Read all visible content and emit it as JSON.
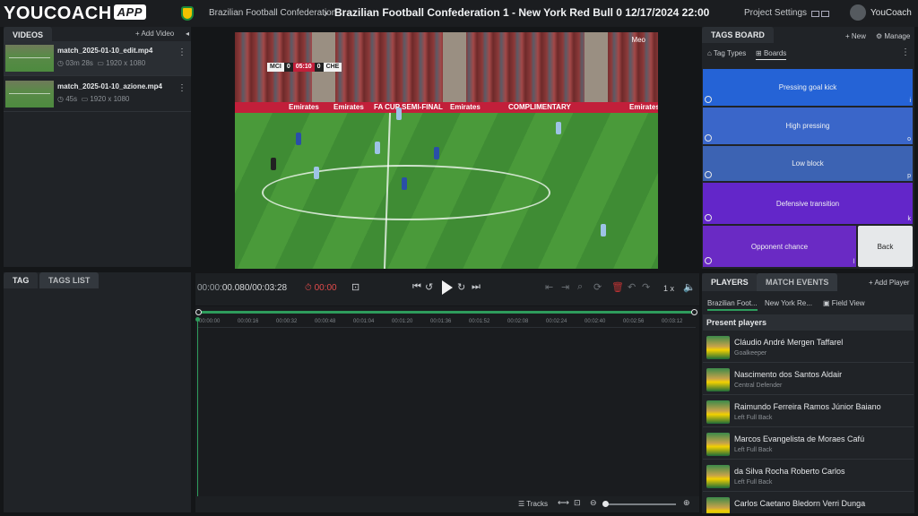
{
  "app": {
    "logo": "YOUCOACH",
    "logo_badge": "APP"
  },
  "header": {
    "breadcrumb": "Brazilian Football Confederation",
    "separator": "›",
    "match_title": "Brazilian Football Confederation 1 - New York Red Bull 0 12/17/2024 22:00",
    "project_settings": "Project Settings",
    "user_name": "YouCoach"
  },
  "videos": {
    "tab": "VIDEOS",
    "add_label": "+ Add Video",
    "collapse": "◂",
    "items": [
      {
        "name": "match_2025-01-10_edit.mp4",
        "duration": "◷ 03m 28s",
        "resolution": "▭ 1920 x 1080"
      },
      {
        "name": "match_2025-01-10_azione.mp4",
        "duration": "◷ 45s",
        "resolution": "▭ 1920 x 1080"
      }
    ],
    "menu": "⋮"
  },
  "tag_panel": {
    "tab_tag": "TAG",
    "tab_list": "TAGS LIST"
  },
  "player": {
    "home": "MCI",
    "home_score": "0",
    "clock": "05:10",
    "away_score": "0",
    "away": "CHE",
    "watermark": "Meo",
    "ads": [
      "Emirates",
      "Emirates",
      "FA CUP SEMI-FINAL",
      "Emirates",
      "COMPLIMENTARY",
      "Emirates"
    ]
  },
  "controls": {
    "time_prefix": "00:00:",
    "time_current": "00.080",
    "time_sep": "/",
    "time_total": "00:03:28",
    "stopwatch": "⏱ 00:00",
    "speed": "1 x"
  },
  "timeline": {
    "ticks": [
      "00:00:00",
      "00:00:16",
      "00:00:32",
      "00:00:48",
      "00:01:04",
      "00:01:20",
      "00:01:36",
      "00:01:52",
      "00:02:08",
      "00:02:24",
      "00:02:40",
      "00:02:56",
      "00:03:12"
    ],
    "tracks_label": "Tracks"
  },
  "tags_board": {
    "tab": "TAGS BOARD",
    "new_label": "+ New",
    "manage_label": "⚙ Manage",
    "tag_types": "Tag Types",
    "boards": "Boards",
    "tags": [
      {
        "label": "Pressing goal kick",
        "key": "i",
        "color": "#2563d6"
      },
      {
        "label": "High pressing",
        "key": "o",
        "color": "#3a66c9"
      },
      {
        "label": "Low block",
        "key": "p",
        "color": "#3c63b3"
      },
      {
        "label": "Defensive transition",
        "key": "k",
        "color": "#6326c9"
      },
      {
        "label": "Opponent chance",
        "key": "l",
        "color": "#6a2ac4"
      }
    ],
    "back": "Back"
  },
  "players": {
    "tab_players": "PLAYERS",
    "tab_events": "MATCH EVENTS",
    "add_player": "+ Add Player",
    "team_home": "Brazilian Foot...",
    "team_away": "New York Re...",
    "field_view": "Field View",
    "present_header": "Present players",
    "list": [
      {
        "name": "Cláudio André Mergen Taffarel",
        "role": "Goalkeeper"
      },
      {
        "name": "Nascimento dos Santos Aldair",
        "role": "Central Defender"
      },
      {
        "name": "Raimundo Ferreira Ramos Júnior Baiano",
        "role": "Left Full Back"
      },
      {
        "name": "Marcos Evangelista de Moraes Cafú",
        "role": "Left Full Back"
      },
      {
        "name": "da Silva Rocha Roberto Carlos",
        "role": "Left Full Back"
      },
      {
        "name": "Carlos Caetano Bledorn Verri Dunga",
        "role": ""
      }
    ]
  }
}
